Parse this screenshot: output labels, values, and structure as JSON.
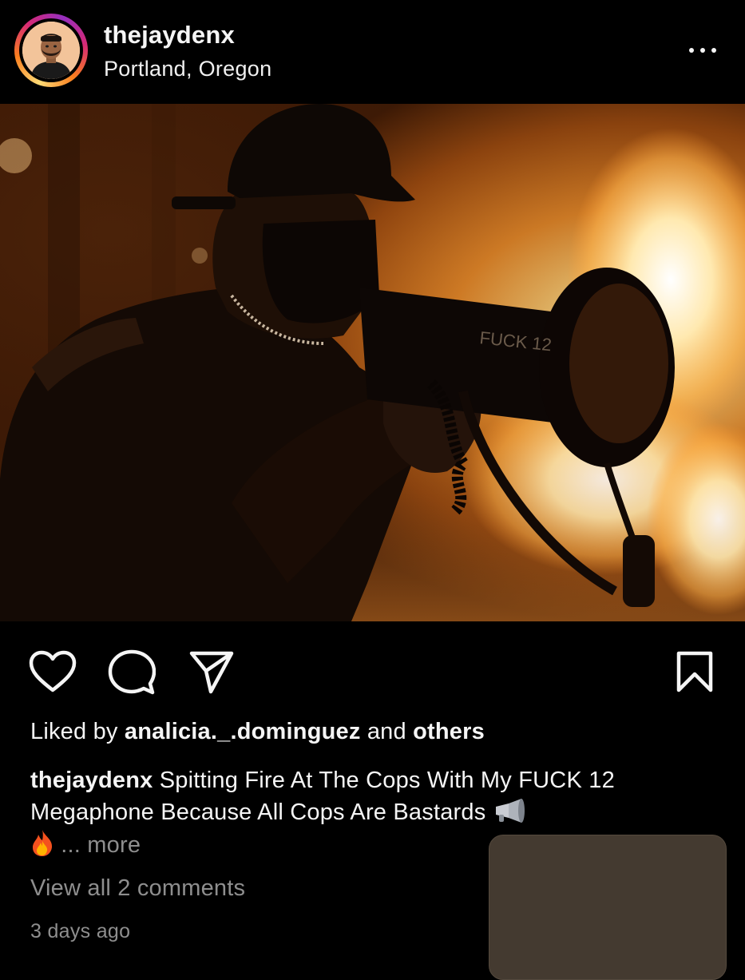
{
  "post": {
    "username": "thejaydenx",
    "location": "Portland, Oregon",
    "likes": {
      "prefix": "Liked by",
      "liker": "analicia._.dominguez",
      "conjunction": "and",
      "others": "others"
    },
    "caption": {
      "username": "thejaydenx",
      "text": "Spitting Fire At The Cops With My FUCK 12 Megaphone Because All Cops Are Bastards",
      "emojis": [
        "megaphone-emoji",
        "fire-emoji"
      ],
      "more": "... more"
    },
    "view_comments": "View all 2 comments",
    "timestamp": "3 days ago",
    "photo_megaphone_text": "FUCK 12"
  },
  "icons": {
    "header": [
      "avatar",
      "more-options-icon"
    ],
    "actions": [
      "heart-icon",
      "comment-icon",
      "share-icon",
      "bookmark-icon"
    ]
  },
  "colors": {
    "background": "#000000",
    "text": "#f5f5f5",
    "secondary_text": "#8e8e8e",
    "story_ring": [
      "#feda75",
      "#fa7e1e",
      "#d62976",
      "#962fbf"
    ]
  }
}
